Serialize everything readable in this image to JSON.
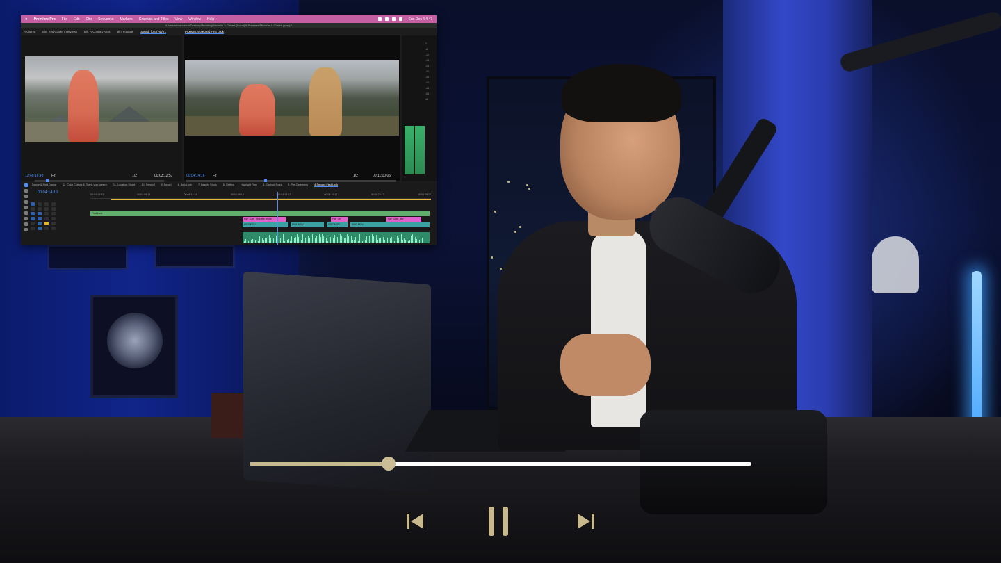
{
  "player": {
    "progress_fraction": 0.277,
    "controls": {
      "prev_icon": "skip-previous-icon",
      "play_state_icon": "pause-icon",
      "next_icon": "skip-next-icon"
    },
    "accent_color": "#c8b98f",
    "track_color": "#ffffff"
  },
  "premiere": {
    "menubar": {
      "items": [
        "Premiere Pro",
        "File",
        "Edit",
        "Clip",
        "Sequence",
        "Markers",
        "Graphics and Titles",
        "View",
        "Window",
        "Help"
      ],
      "clock": "Sun Dec 4  4:47"
    },
    "path": "/Users/alexanderna/Desktop/Wedding/Michelle & Garrett (Socal)/6 Premiere/Michelle & Garrett.prproj *",
    "source_tabs": [
      "A-Garrett",
      "Bin: Red Carpet Interviews",
      "Bin: A-Contact Ross",
      "Bin: Footage",
      "Sound: [DSX]-M/V1"
    ],
    "program_tabs": [
      "Program: 6-Second First Look"
    ],
    "source": {
      "timecode_in": "12;46;16;49",
      "fit": "Fit",
      "ratio": "1/2",
      "timecode_out": "00;03;12;57"
    },
    "program": {
      "timecode_in": "00:04:14:16",
      "fit": "Fit",
      "ratio": "1/2",
      "timecode_out": "00:11:10:05"
    },
    "meter_scale": [
      "0",
      "-6",
      "-12",
      "-18",
      "-24",
      "-30",
      "-36",
      "-42",
      "-48",
      "-54",
      "dB"
    ],
    "timeline": {
      "current_tc": "00:04:14:16",
      "sequence_tabs": [
        "Dance & First Dance",
        "12. Cake Cutting & Thank you speech",
        "11. Location Shoot",
        "10. Sendoff",
        "9. Beach",
        "8. Bea Look",
        "7. Beauty Shots",
        "6. Getting",
        "Highlight Film",
        "4. Contact Ross",
        "3. Pre-Ceremony",
        "4-Second First Look"
      ],
      "ruler_labels": [
        "00:04:14:23",
        "00:04:09:18",
        "00:04:14:18",
        "00:04:09:18",
        "00:04:14:17",
        "00:04:19:17",
        "00:04:24:17",
        "00:04:29:17"
      ],
      "clips": {
        "green_top": "First Look",
        "pink_1": "Fwr_Cam_Michelle Shots",
        "pink_2": "Fwr_Cn",
        "pink_3": "Fwr_Cam_dlw",
        "teal_1": "0023.MOV",
        "teal_2": "0051.MOV",
        "teal_3": "0057.MOV",
        "teal_4": "0063.MOV"
      }
    }
  }
}
